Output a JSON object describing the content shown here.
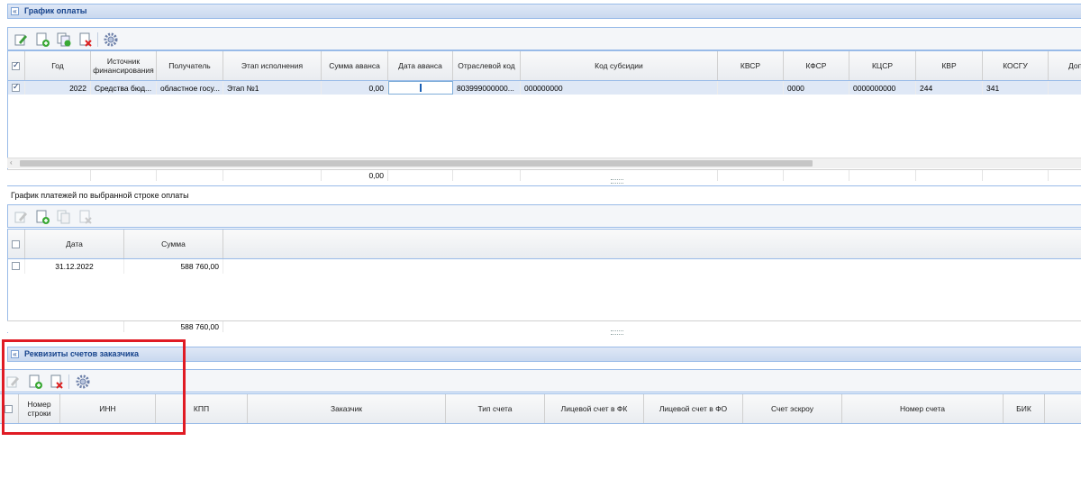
{
  "section1": {
    "title": "График оплаты",
    "columns": [
      "Год",
      "Источник финансирования",
      "Получатель",
      "Этап исполнения",
      "Сумма аванса",
      "Дата аванса",
      "Отраслевой код",
      "Код субсидии",
      "КВСР",
      "КФСР",
      "КЦСР",
      "КВР",
      "КОСГУ",
      "Доп."
    ],
    "row": {
      "year": "2022",
      "source": "Средства бюд...",
      "recipient": "областное госу...",
      "stage": "Этап №1",
      "advance_sum": "0,00",
      "advance_date": "",
      "industry_code": "803999000000...",
      "subsidy_code": "000000000",
      "kvsr": "",
      "kfsr": "0000",
      "kcsr": "0000000000",
      "kvr": "244",
      "kosgu": "341",
      "extra": ""
    },
    "total_advance": "0,00"
  },
  "section2": {
    "title": "График платежей по выбранной строке оплаты",
    "columns": [
      "Дата",
      "Сумма"
    ],
    "row": {
      "date": "31.12.2022",
      "sum": "588 760,00"
    },
    "total_sum": "588 760,00"
  },
  "section3": {
    "title": "Реквизиты счетов заказчика",
    "columns": [
      "Номер строки",
      "ИНН",
      "КПП",
      "Заказчик",
      "Тип счета",
      "Лицевой счет в ФК",
      "Лицевой счет в ФО",
      "Счет эскроу",
      "Номер счета",
      "БИК"
    ]
  },
  "colors": {
    "highlight_box": "#e01b24",
    "header_text": "#15428b",
    "border": "#99bbe8",
    "selected_row": "#dfe8f6"
  }
}
